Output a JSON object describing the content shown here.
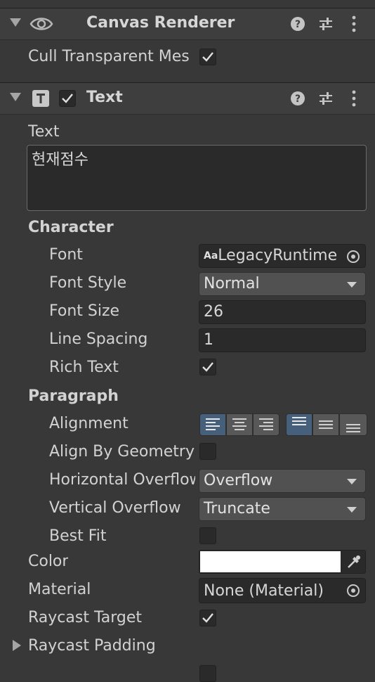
{
  "canvas_renderer": {
    "title": "Canvas Renderer",
    "cull_label": "Cull Transparent Mes",
    "cull_checked": true
  },
  "text_component": {
    "title": "Text",
    "enabled": true,
    "text_label": "Text",
    "text_value": "현재점수",
    "character_header": "Character",
    "font_label": "Font",
    "font_value": "LegacyRuntime",
    "font_icon": "Aa",
    "font_style_label": "Font Style",
    "font_style_value": "Normal",
    "font_size_label": "Font Size",
    "font_size_value": "26",
    "line_spacing_label": "Line Spacing",
    "line_spacing_value": "1",
    "rich_text_label": "Rich Text",
    "rich_text_checked": true,
    "paragraph_header": "Paragraph",
    "alignment_label": "Alignment",
    "align_geometry_label": "Align By Geometry",
    "align_geometry_checked": false,
    "horizontal_overflow_label": "Horizontal Overflow",
    "horizontal_overflow_value": "Overflow",
    "vertical_overflow_label": "Vertical Overflow",
    "vertical_overflow_value": "Truncate",
    "best_fit_label": "Best Fit",
    "best_fit_checked": false,
    "color_label": "Color",
    "color_value": "#ffffff",
    "material_label": "Material",
    "material_value": "None (Material)",
    "raycast_target_label": "Raycast Target",
    "raycast_target_checked": true,
    "raycast_padding_label": "Raycast Padding"
  },
  "colors": {
    "panel_bg": "#383838",
    "header_bg": "#3e3e3e",
    "field_bg": "#2a2a2a",
    "dropdown_bg": "#515151",
    "align_active": "#46607c"
  }
}
